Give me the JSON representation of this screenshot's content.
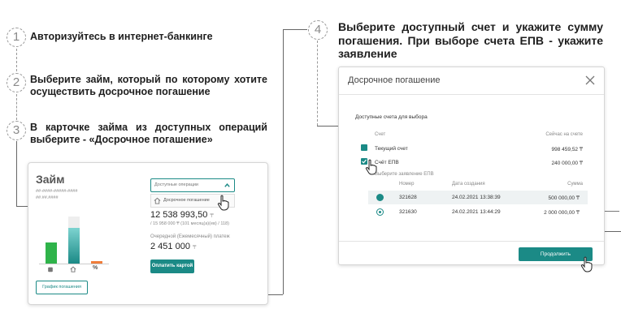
{
  "steps": [
    {
      "num": "1",
      "text": "Авторизуйтесь в интернет-банкинге"
    },
    {
      "num": "2",
      "text": "Выберите займ, который по которому хотите осуществить досрочное погашение"
    },
    {
      "num": "3",
      "text": "В карточке займа из доступных операций выберите - «Досрочное погашение»"
    },
    {
      "num": "4",
      "text": "Выберите доступный счет и укажите сумму погашения. При выборе счета ЕПВ - укажите заявление"
    }
  ],
  "loan_card": {
    "title": "Займ",
    "sub1": "##-####-#####-####",
    "sub2": "##.##.####",
    "ops_placeholder": "Доступные операции",
    "ops_item": "Досрочное погашение",
    "amount": "12 538 993,50",
    "amount_sub": "/ 15 958 000 ₸ (101 месяц(а)(ев) / 118)",
    "next_payment_label": "Очередной (Ежемесячный) платеж",
    "next_payment": "2 451 000",
    "pay_button": "Оплатить картой",
    "schedule_button": "График погашения",
    "percent": "%",
    "bars": [
      {
        "name": "green",
        "value": 0.45,
        "color": "#2fb34a"
      },
      {
        "name": "teal",
        "value": 0.75,
        "color": "#1b8a86"
      },
      {
        "name": "orange",
        "value": 0.05,
        "color": "#f07d3a"
      }
    ]
  },
  "modal": {
    "title": "Досрочное погашение",
    "section": "Доступные счета для выбора",
    "col_account": "Счет",
    "col_now": "Сейчас на счете",
    "accounts": [
      {
        "name": "Текущий счет",
        "amount": "998 459,52 ₸"
      },
      {
        "name": "Счёт ЕПВ",
        "amount": "240 000,00 ₸"
      }
    ],
    "epv_label": "Выберите заявление ЕПВ",
    "app_headers": {
      "number": "Номер",
      "date": "Дата создания",
      "sum": "Сумма"
    },
    "applications": [
      {
        "number": "321628",
        "date": "24.02.2021 13:38:39",
        "sum": "500 000,00 ₸"
      },
      {
        "number": "321630",
        "date": "24.02.2021 13:44:29",
        "sum": "2 000 000,00 ₸"
      }
    ],
    "continue_button": "Продолжить"
  },
  "colors": {
    "accent": "#1b8a86",
    "green": "#2fb34a",
    "orange": "#f07d3a"
  }
}
